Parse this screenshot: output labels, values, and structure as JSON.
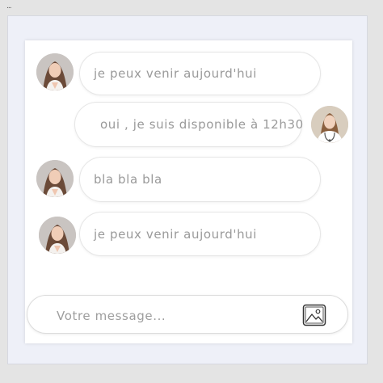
{
  "window": {
    "menu_dots": "..."
  },
  "messages": [
    {
      "side": "left",
      "sender": "patient",
      "text": "je peux venir aujourd'hui"
    },
    {
      "side": "right",
      "sender": "doctor",
      "text": "oui , je suis disponible à 12h30"
    },
    {
      "side": "left",
      "sender": "patient",
      "text": "bla bla bla"
    },
    {
      "side": "left",
      "sender": "patient",
      "text": "je peux venir aujourd'hui"
    }
  ],
  "composer": {
    "placeholder": "Votre message...",
    "value": "",
    "attach_icon": "image-icon"
  },
  "colors": {
    "page_background": "#e4e4e4",
    "frame_background": "#eef0f8",
    "card_background": "#ffffff",
    "bubble_text": "#9a9a9a",
    "bubble_border": "#e6e6e6"
  }
}
